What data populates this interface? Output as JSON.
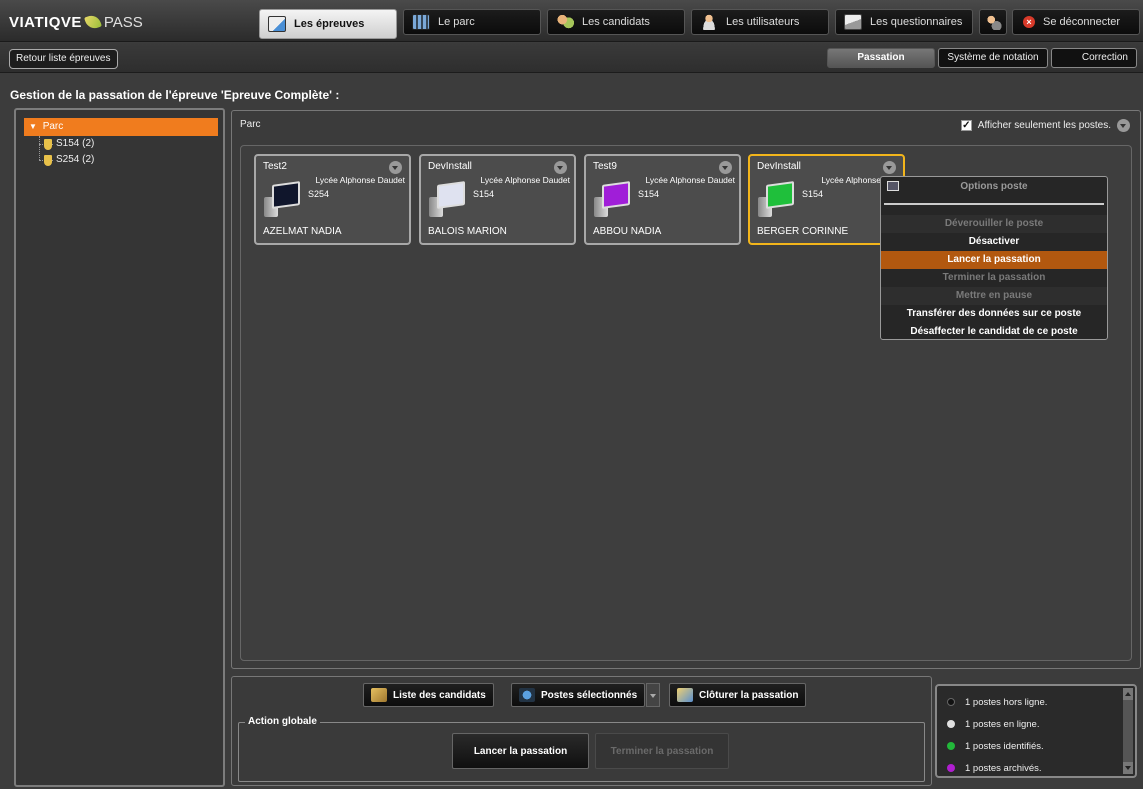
{
  "app": {
    "brand": "VIATIQVE",
    "product": "PASS"
  },
  "nav": {
    "tabs": [
      {
        "label": "Les épreuves",
        "icon": "edit-icon",
        "active": true
      },
      {
        "label": "Le parc",
        "icon": "building-icon"
      },
      {
        "label": "Les candidats",
        "icon": "people-icon"
      },
      {
        "label": "Les utilisateurs",
        "icon": "person-icon"
      },
      {
        "label": "Les questionnaires",
        "icon": "quiz-icon"
      },
      {
        "label": "",
        "icon": "user-settings-icon"
      },
      {
        "label": "Se déconnecter",
        "icon": "close-icon"
      }
    ]
  },
  "subnav": {
    "back": "Retour liste épreuves",
    "tabs": [
      {
        "label": "Passation",
        "active": true
      },
      {
        "label": "Système de notation"
      },
      {
        "label": "Correction"
      }
    ]
  },
  "page": {
    "title": "Gestion de la passation de l'épreuve 'Epreuve Complète' :"
  },
  "tree": {
    "root": "Parc",
    "items": [
      {
        "label": "S154 (2)"
      },
      {
        "label": "S254 (2)"
      }
    ]
  },
  "parc": {
    "label": "Parc",
    "show_only_label": "Afficher seulement les postes.",
    "show_only_checked": "✓",
    "postes": [
      {
        "name": "Test2",
        "school": "Lycée Alphonse Daudet",
        "room": "S254",
        "candidate": "AZELMAT NADIA",
        "screen_color": "#10162c",
        "selected": false
      },
      {
        "name": "DevInstall",
        "school": "Lycée Alphonse Daudet",
        "room": "S154",
        "candidate": "BALOIS MARION",
        "screen_color": "#dfe2f0",
        "selected": false
      },
      {
        "name": "Test9",
        "school": "Lycée Alphonse Daudet",
        "room": "S154",
        "candidate": "ABBOU NADIA",
        "screen_color": "#a01ed8",
        "selected": false
      },
      {
        "name": "DevInstall",
        "school": "Lycée Alphonse Dau",
        "room": "S154",
        "candidate": "BERGER CORINNE",
        "screen_color": "#1fbf3b",
        "selected": true
      }
    ]
  },
  "context_menu": {
    "title": "Options poste",
    "items": [
      {
        "label": "Déverouiller le poste",
        "state": "disabled"
      },
      {
        "label": "Désactiver",
        "state": "enabled"
      },
      {
        "label": "Lancer la passation",
        "state": "highlighted"
      },
      {
        "label": "Terminer la passation",
        "state": "disabled"
      },
      {
        "label": "Mettre en pause",
        "state": "disabled"
      },
      {
        "label": "Transférer des données sur ce poste",
        "state": "enabled"
      },
      {
        "label": "Désaffecter le candidat de ce poste",
        "state": "enabled"
      }
    ]
  },
  "bottom": {
    "buttons": [
      {
        "label": "Liste des candidats"
      },
      {
        "label": "Postes sélectionnés"
      },
      {
        "label": "Clôturer la passation"
      }
    ],
    "global_action": {
      "legend": "Action globale",
      "start": "Lancer la passation",
      "stop": "Terminer la passation"
    }
  },
  "status": [
    {
      "label": "1 postes hors ligne.",
      "color": "#111111"
    },
    {
      "label": "1 postes en ligne.",
      "color": "#e0e0e0"
    },
    {
      "label": "1 postes identifiés.",
      "color": "#22b83a"
    },
    {
      "label": "1 postes archivés.",
      "color": "#b01ed0"
    }
  ],
  "colors": {
    "accent": "#f07c1e",
    "selected_border": "#f2b51b",
    "menu_highlight": "#b2580f"
  }
}
